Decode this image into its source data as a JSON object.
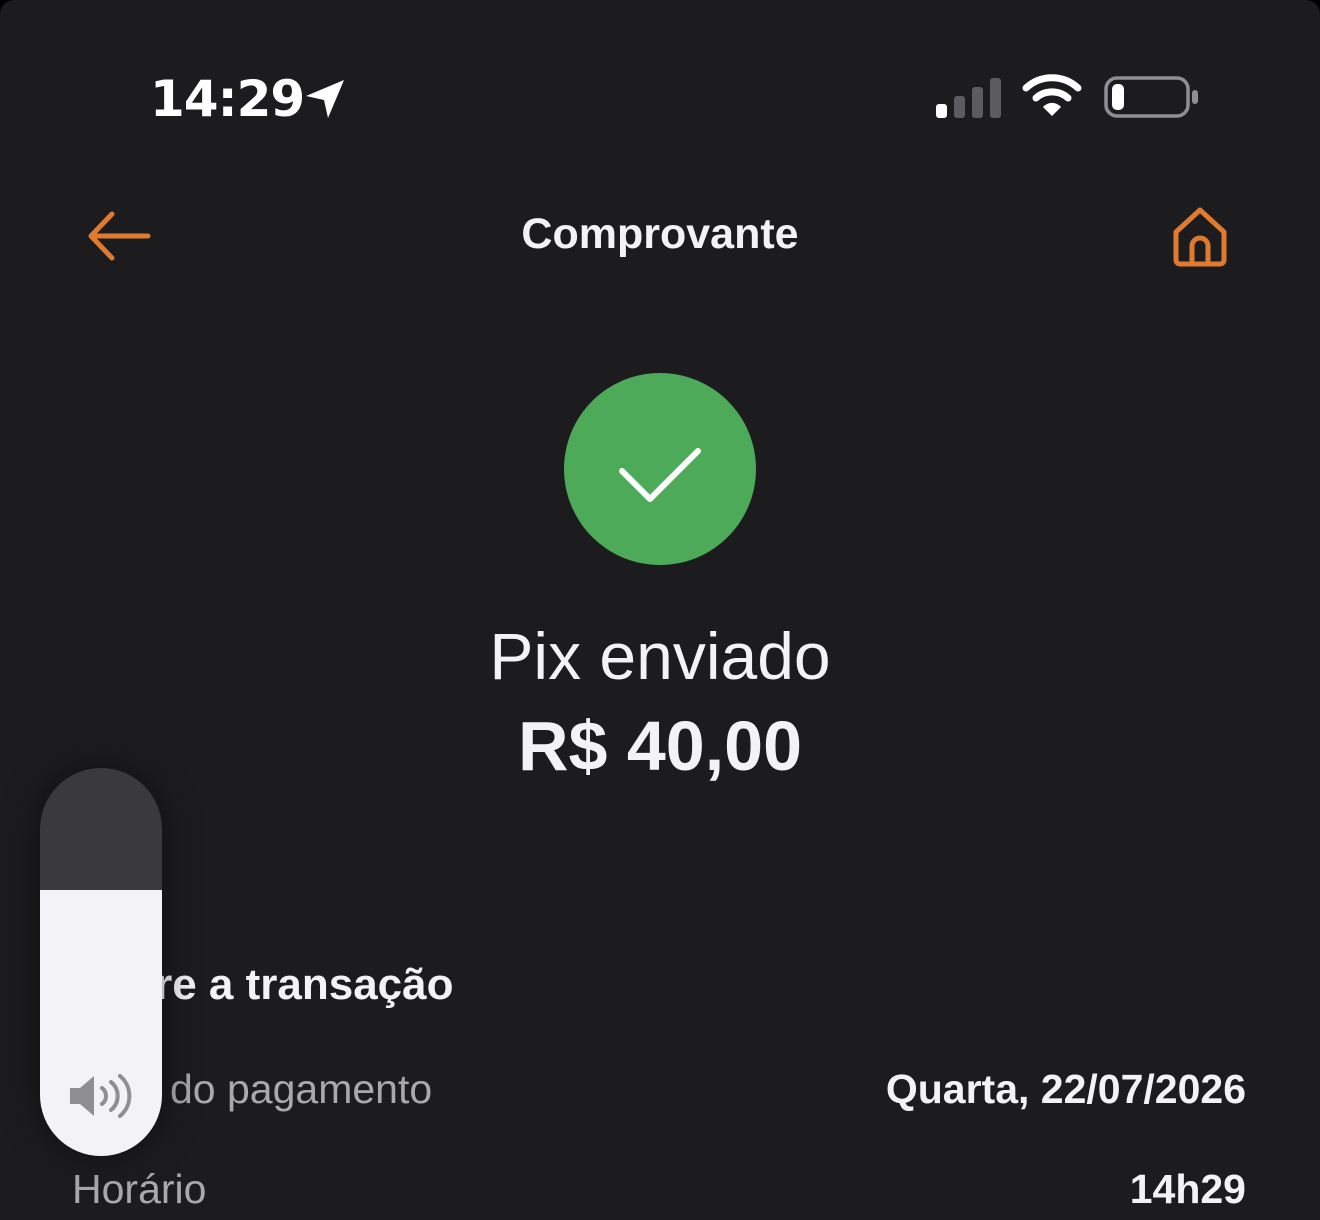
{
  "status_bar": {
    "time": "14:29",
    "location_icon": "location-arrow-icon",
    "signal_icon": "cellular-signal-icon",
    "wifi_icon": "wifi-icon",
    "battery_icon": "battery-icon",
    "battery_level": 0.12
  },
  "header": {
    "title": "Comprovante",
    "back_icon": "arrow-left-icon",
    "home_icon": "home-icon",
    "accent_color": "#e07a2e"
  },
  "receipt": {
    "success_icon": "checkmark-icon",
    "success_color": "#4caa59",
    "status": "Pix enviado",
    "amount": "R$ 40,00"
  },
  "details": {
    "section_title": "Sobre a transação",
    "rows": [
      {
        "label": "Data do pagamento",
        "value": "Quarta, 22/07/2026"
      },
      {
        "label": "Horário",
        "value": "14h29"
      }
    ]
  },
  "volume_hud": {
    "icon": "speaker-icon",
    "level_percent": 69
  }
}
